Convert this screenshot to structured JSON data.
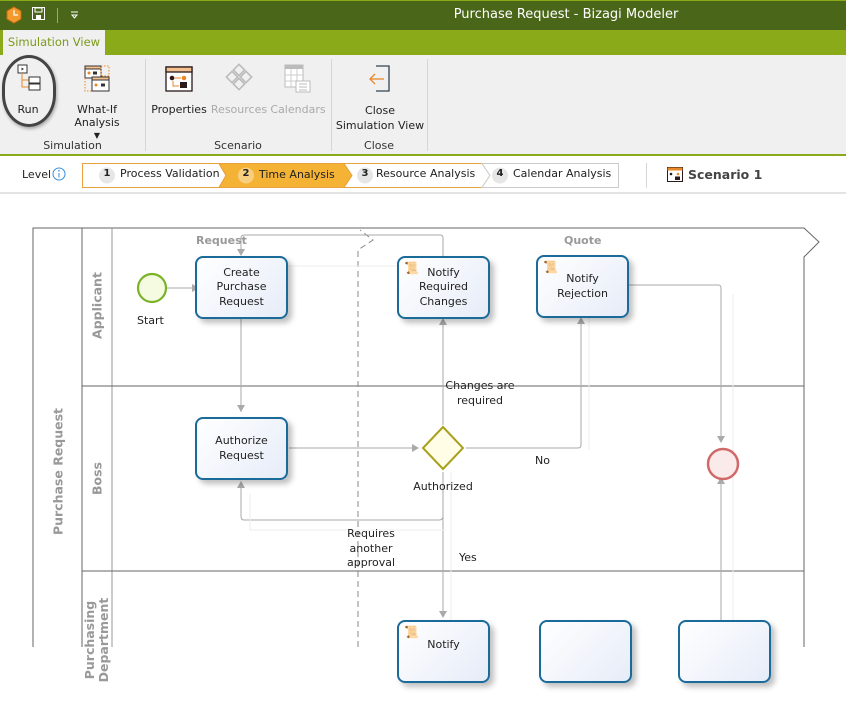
{
  "window": {
    "title": "Purchase Request - Bizagi Modeler",
    "quick_access": [
      "app-logo-icon",
      "save-icon",
      "customize-dropdown-icon"
    ]
  },
  "ribbon": {
    "active_tab": "Simulation View",
    "groups": [
      {
        "label": "Simulation",
        "buttons": [
          {
            "label": "Run",
            "icon": "run-icon",
            "enabled": true,
            "highlighted": true
          },
          {
            "label": "What-If Analysis",
            "icon": "what-if-icon",
            "enabled": true,
            "has_dropdown": true
          }
        ]
      },
      {
        "label": "Scenario",
        "buttons": [
          {
            "label": "Properties",
            "icon": "properties-icon",
            "enabled": true
          },
          {
            "label": "Resources",
            "icon": "resources-icon",
            "enabled": false
          },
          {
            "label": "Calendars",
            "icon": "calendars-icon",
            "enabled": false
          }
        ]
      },
      {
        "label": "Close",
        "buttons": [
          {
            "label_line1": "Close",
            "label_line2": "Simulation View",
            "icon": "close-view-icon",
            "enabled": true
          }
        ]
      }
    ]
  },
  "level_bar": {
    "label": "Level",
    "steps": [
      {
        "num": "1",
        "label": "Process Validation",
        "active": false
      },
      {
        "num": "2",
        "label": "Time Analysis",
        "active": true
      },
      {
        "num": "3",
        "label": "Resource Analysis",
        "active": false
      },
      {
        "num": "4",
        "label": "Calendar Analysis",
        "active": false
      }
    ],
    "scenario": "Scenario 1",
    "accent": "#f5b335"
  },
  "diagram": {
    "pool": "Purchase Request",
    "lanes": [
      "Applicant",
      "Boss",
      "Purchasing Department"
    ],
    "phases": [
      "Request",
      "Quote"
    ],
    "start_event": "Start",
    "tasks": {
      "create": [
        "Create",
        "Purchase",
        "Request"
      ],
      "notify_changes": [
        "Notify",
        "Required",
        "Changes"
      ],
      "notify_rejection": [
        "Notify",
        "Rejection"
      ],
      "authorize": [
        "Authorize",
        "Request"
      ],
      "notify_bottom": "Notify"
    },
    "gateway": "Authorized",
    "flow_labels": {
      "changes": [
        "Changes are",
        "required"
      ],
      "no": "No",
      "yes": "Yes",
      "another": [
        "Requires",
        "another",
        "approval"
      ]
    },
    "colors": {
      "task_border": "#1a6a9a",
      "start": "#7ab32a",
      "end": "#d06a6a",
      "gateway": "#a8a020"
    }
  }
}
